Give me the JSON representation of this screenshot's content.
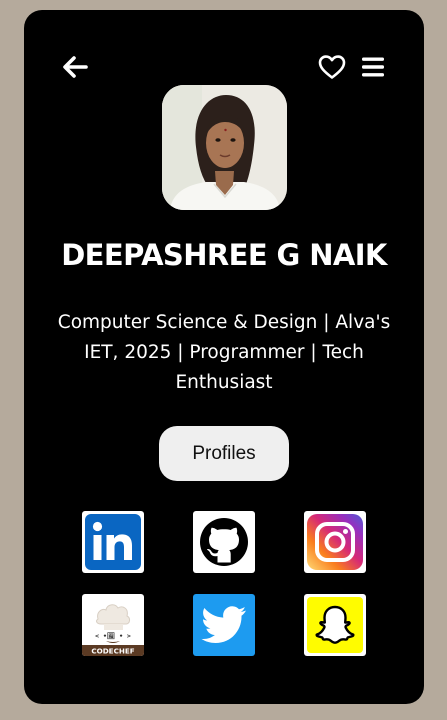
{
  "profile": {
    "name": "DEEPASHREE G NAIK",
    "tagline": "Computer Science & Design | Alva's IET, 2025 | Programmer | Tech Enthusiast"
  },
  "buttons": {
    "profiles_label": "Profiles"
  },
  "social": {
    "codechef_label": "CODECHEF"
  },
  "icons": {
    "back": "back-arrow-icon",
    "favorite": "heart-icon",
    "menu": "hamburger-menu-icon"
  },
  "colors": {
    "page_background": "#b5aa9c",
    "card_background": "#000000",
    "text": "#ffffff",
    "button_background": "#efefef",
    "linkedin": "#0a66c2",
    "twitter": "#1d9bf0",
    "snapchat": "#fffc00"
  }
}
